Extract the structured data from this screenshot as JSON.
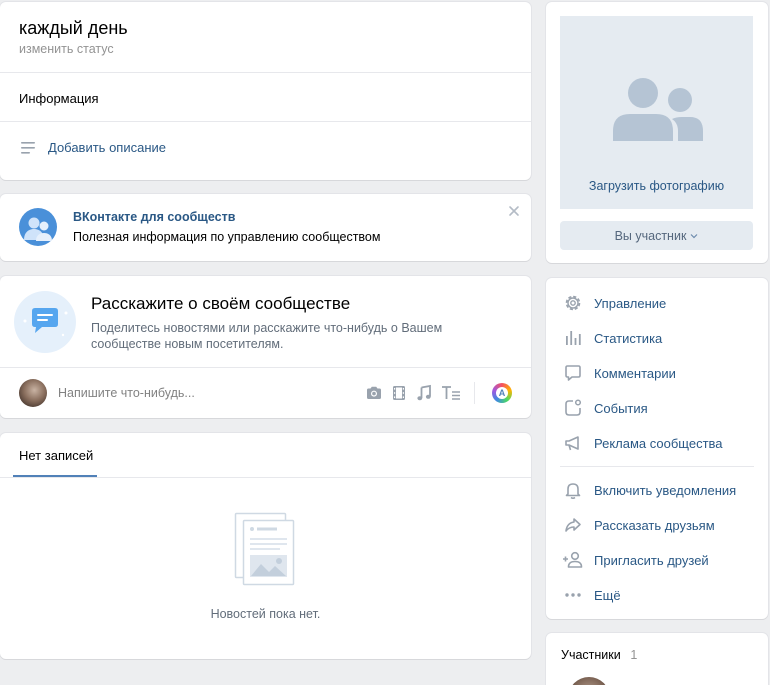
{
  "status": {
    "title": "каждый день",
    "change_status": "изменить статус",
    "info_label": "Информация",
    "add_description": "Добавить описание"
  },
  "promo": {
    "title": "ВКонтакте для сообществ",
    "text": "Полезная информация по управлению сообществом"
  },
  "tell": {
    "title": "Расскажите о своём сообществе",
    "text_line1": "Поделитесь новостями или расскажите что-нибудь о Вашем",
    "text_line2": "сообществе новым посетителям.",
    "placeholder": "Напишите что-нибудь..."
  },
  "wall": {
    "tab": "Нет записей",
    "empty": "Новостей пока нет."
  },
  "photo": {
    "upload": "Загрузить фотографию",
    "member_button": "Вы участник"
  },
  "menu": {
    "items": [
      {
        "label": "Управление",
        "icon": "gear-icon"
      },
      {
        "label": "Статистика",
        "icon": "stats-icon"
      },
      {
        "label": "Комментарии",
        "icon": "comment-icon"
      },
      {
        "label": "События",
        "icon": "events-icon"
      },
      {
        "label": "Реклама сообщества",
        "icon": "megaphone-icon"
      },
      {
        "label": "Включить уведомления",
        "icon": "bell-icon"
      },
      {
        "label": "Рассказать друзьям",
        "icon": "share-icon"
      },
      {
        "label": "Пригласить друзей",
        "icon": "add-user-icon"
      },
      {
        "label": "Ещё",
        "icon": "more-icon"
      }
    ]
  },
  "members": {
    "label": "Участники",
    "count": "1"
  },
  "colors": {
    "link": "#2a5885",
    "icon": "#99a2ad",
    "accent": "#5181b8",
    "background": "#edeef0"
  }
}
